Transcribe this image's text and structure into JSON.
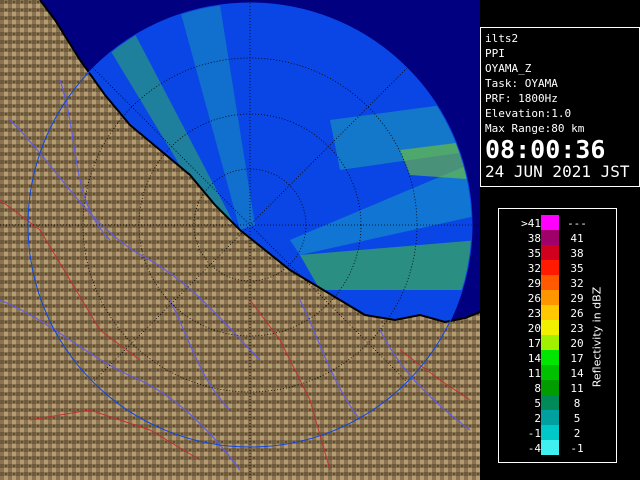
{
  "panel": {
    "lines": [
      "ilts2",
      "PPI",
      "OYAMA_Z",
      "Task: OYAMA",
      "PRF: 1800Hz",
      "Elevation:1.0",
      "Max Range:80 km"
    ],
    "time": "08:00:36",
    "date": "24 JUN 2021 JST"
  },
  "legend": {
    "title": "Reflectivity in dBZ",
    "rows": [
      {
        "low": ">41",
        "high": "---",
        "color": "#ff00ff"
      },
      {
        "low": "38",
        "high": "41",
        "color": "#a0006a"
      },
      {
        "low": "35",
        "high": "38",
        "color": "#d0001e"
      },
      {
        "low": "32",
        "high": "35",
        "color": "#ff1a00"
      },
      {
        "low": "29",
        "high": "32",
        "color": "#ff5a00"
      },
      {
        "low": "26",
        "high": "29",
        "color": "#ff9600"
      },
      {
        "low": "23",
        "high": "26",
        "color": "#ffc800"
      },
      {
        "low": "20",
        "high": "23",
        "color": "#f0f000"
      },
      {
        "low": "17",
        "high": "20",
        "color": "#a0f000"
      },
      {
        "low": "14",
        "high": "17",
        "color": "#00e600"
      },
      {
        "low": "11",
        "high": "14",
        "color": "#00c000"
      },
      {
        "low": "8",
        "high": "11",
        "color": "#009c00"
      },
      {
        "low": "5",
        "high": "8",
        "color": "#008a5a"
      },
      {
        "low": "2",
        "high": "5",
        "color": "#00a0a0"
      },
      {
        "low": "-1",
        "high": "2",
        "color": "#00c8c8"
      },
      {
        "low": "-4",
        "high": "-1",
        "color": "#40f0f0"
      }
    ]
  },
  "colors": {
    "sea_in_range": "#0a46e6",
    "sea_outside": "#000080",
    "land": "#8a7350",
    "coast": "#000000",
    "rivers": "#5a5af0",
    "roads": "#c82828",
    "range_rings": "#000000"
  }
}
